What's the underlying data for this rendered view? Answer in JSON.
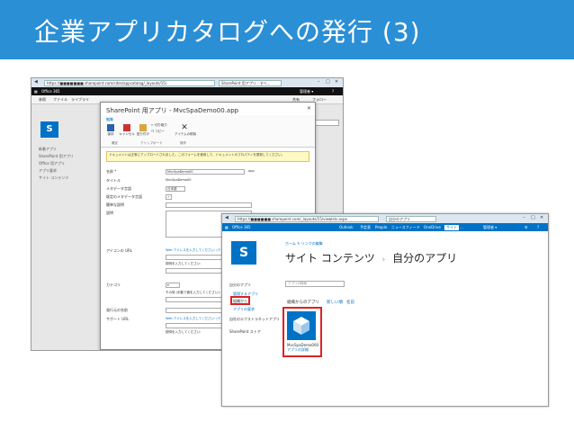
{
  "slide": {
    "title": "企業アプリカタログへの発行 (3)",
    "colors": {
      "title_bar": "#2b8fd6",
      "sharepoint_blue": "#0072c6",
      "highlight_red": "#dd2222"
    }
  },
  "screenshot1": {
    "browser": {
      "url": "https://■■■■■■■.sharepoint.com/sites/appcatalog/_layouts/15/",
      "tab_label": "SharePoint 用アプリ - すべ...",
      "win_controls": [
        "–",
        "□",
        "✕"
      ]
    },
    "topbar": {
      "brand": "Office 365",
      "right_items": [
        "管理者 ▾",
        "?"
      ]
    },
    "ribbon_tabs": [
      "参照",
      "ファイル",
      "ライブラリ"
    ],
    "ribbon_right": [
      "共有",
      "フォロー"
    ],
    "left_nav": [
      "新着アプリ",
      "SharePoint 用アプリ",
      "Office 用アプリ",
      "アプリ要求",
      "サイト コンテンツ"
    ],
    "search_placeholder": "ch",
    "dialog": {
      "title": "SharePoint 用アプリ - MvcSpaDemo00.app",
      "close": "✕",
      "ribbon_tab": "編集",
      "buttons": [
        {
          "label": "保存",
          "icon": "save-icon"
        },
        {
          "label": "キャンセル",
          "icon": "cancel-icon"
        },
        {
          "label": "貼り付け",
          "icon": "paste-icon"
        },
        {
          "label": "切り取り",
          "icon": "cut-icon"
        },
        {
          "label": "コピー",
          "icon": "copy-icon"
        },
        {
          "label": "アイテムの削除",
          "icon": "delete-icon"
        }
      ],
      "groups": [
        "確定",
        "クリップボード",
        "操作"
      ],
      "warning": "ドキュメントは正常にアップロードされました。このフォームを使用して、ドキュメントのプロパティを更新してください。",
      "fields": [
        {
          "label": "名前 *",
          "value": "MvcSpaDemo00",
          "suffix": ".app"
        },
        {
          "label": "タイトル",
          "value": "MvcSpaDemo00"
        },
        {
          "label": "メタデータ言語",
          "value": "日本語"
        },
        {
          "label": "既定のメタデータ言語",
          "value": "✓"
        },
        {
          "label": "簡単な説明",
          "value": ""
        },
        {
          "label": "説明",
          "value": ""
        },
        {
          "label": "アイコンの URL",
          "value": "Web アドレスを入力してください: (テストする)"
        },
        {
          "label": "",
          "value": "説明を入力してください:"
        },
        {
          "label": "カテゴリ",
          "value": "▾"
        },
        {
          "label": "",
          "value": "その他 (手動で値を入力してください):"
        },
        {
          "label": "発行元の名前",
          "value": ""
        },
        {
          "label": "サポート URL",
          "value": "Web アドレスを入力してください: (テストする)"
        },
        {
          "label": "",
          "value": "説明を入力してください:"
        }
      ]
    }
  },
  "screenshot2": {
    "browser": {
      "url": "https://■■■■■■.sharepoint.com/_layouts/15/viewlsts.aspx",
      "tab_label": "自分のアプリ",
      "win_controls": [
        "–",
        "□",
        "✕"
      ]
    },
    "topbar": {
      "brand": "Office 365",
      "items": [
        "Outlook",
        "予定表",
        "People",
        "ニュースフィード",
        "OneDrive",
        "サイト",
        "…"
      ],
      "right_items": [
        "管理者 ▾",
        "⚙",
        "?"
      ]
    },
    "page": {
      "breadcrumb": "ホーム   ✎ リンクの編集",
      "title_main": "サイト コンテンツ",
      "separator": "›",
      "title_sub": "自分のアプリ",
      "search_placeholder": "アプリの検索",
      "left_nav": [
        "自分のアプリ",
        "管理するアプリ",
        "組織から",
        "アプリの要求",
        "自社のエクストラネットアプリ",
        "SharePoint ストア"
      ],
      "tabs": [
        "組織からのアプリ",
        "新しい順",
        "名前"
      ],
      "app_tile": {
        "name": "MvcSpaDemo000",
        "link": "アプリの詳細"
      }
    }
  }
}
